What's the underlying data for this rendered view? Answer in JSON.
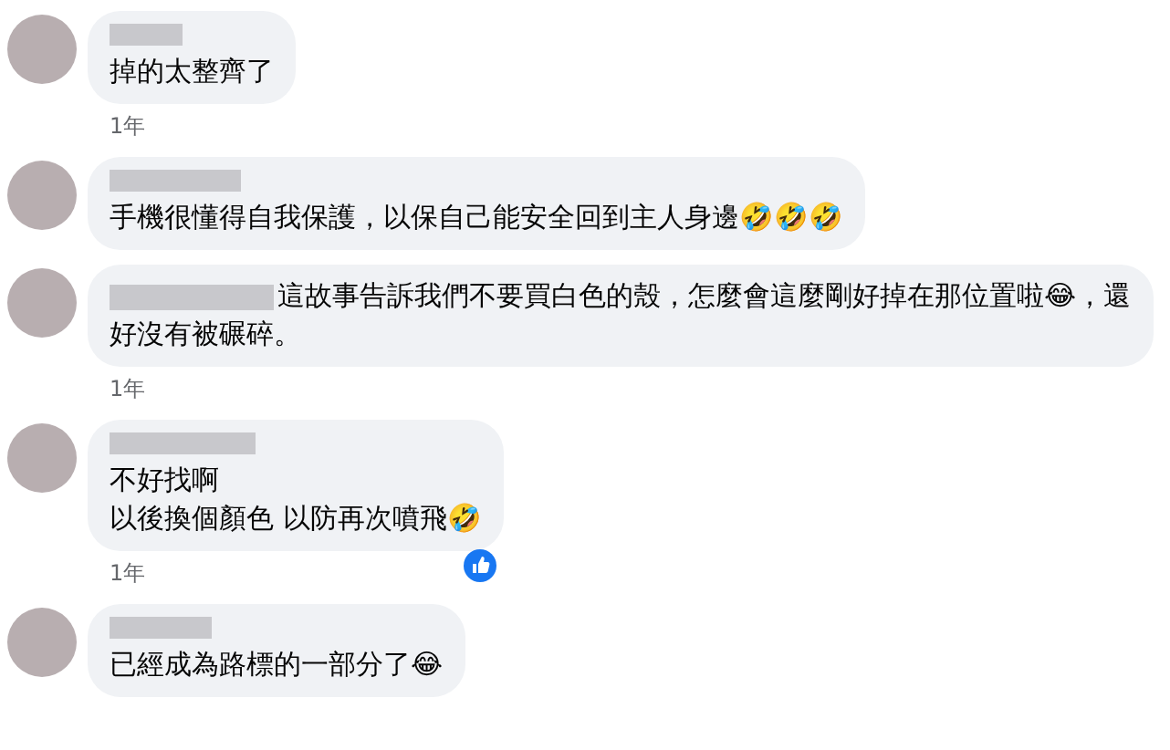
{
  "comments": [
    {
      "kind": "stacked",
      "lines": [
        "掉的太整齊了"
      ],
      "time": "1年",
      "liked": false
    },
    {
      "kind": "stacked",
      "lines": [
        "手機很懂得自我保護，以保自己能安全回到主人身邊🤣🤣🤣"
      ],
      "liked": false
    },
    {
      "kind": "inline",
      "lines": [
        "這故事告訴我們不要買白色的殼，怎麼會這麼剛好掉在那位置啦😂，還好沒有被碾碎。"
      ],
      "time": "1年",
      "liked": false
    },
    {
      "kind": "stacked",
      "lines": [
        "不好找啊",
        "以後換個顏色 以防再次噴飛🤣"
      ],
      "time": "1年",
      "liked": true
    },
    {
      "kind": "stacked",
      "lines": [
        "已經成為路標的一部分了😂"
      ],
      "liked": false
    }
  ]
}
